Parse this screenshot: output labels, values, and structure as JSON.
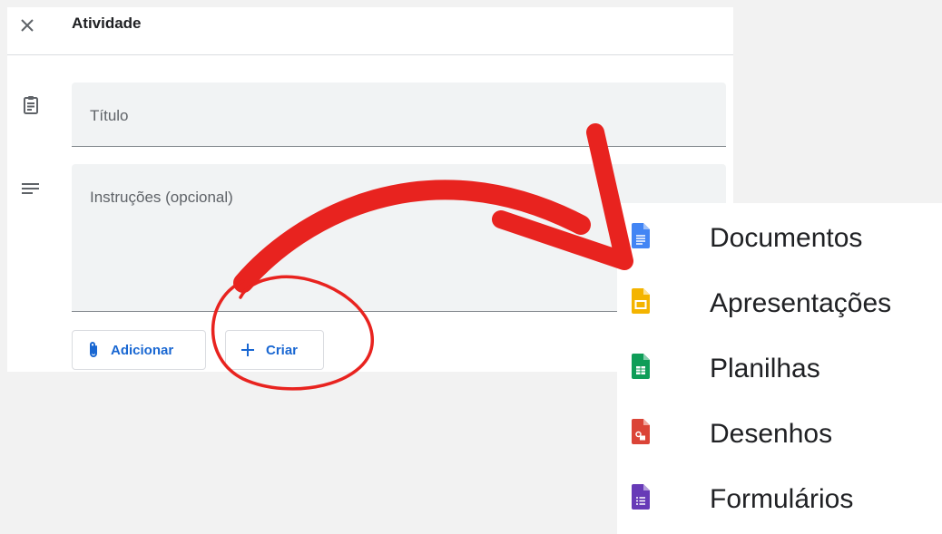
{
  "header": {
    "title": "Atividade",
    "close_icon": "close-icon"
  },
  "form": {
    "title_placeholder": "Título",
    "instructions_placeholder": "Instruções (opcional)",
    "title_icon": "clipboard-icon",
    "instructions_icon": "short-text-icon"
  },
  "actions": {
    "add_label": "Adicionar",
    "add_icon": "paperclip-icon",
    "create_label": "Criar",
    "create_icon": "plus-icon",
    "accent_color": "#1967d2"
  },
  "create_menu": {
    "items": [
      {
        "label": "Documentos",
        "icon": "google-docs-icon",
        "color": "#4285f4"
      },
      {
        "label": "Apresentações",
        "icon": "google-slides-icon",
        "color": "#f4b400"
      },
      {
        "label": "Planilhas",
        "icon": "google-sheets-icon",
        "color": "#0f9d58"
      },
      {
        "label": "Desenhos",
        "icon": "google-drawings-icon",
        "color": "#db4437"
      },
      {
        "label": "Formulários",
        "icon": "google-forms-icon",
        "color": "#673ab7"
      }
    ]
  },
  "annotation": {
    "color": "#e8231f"
  }
}
